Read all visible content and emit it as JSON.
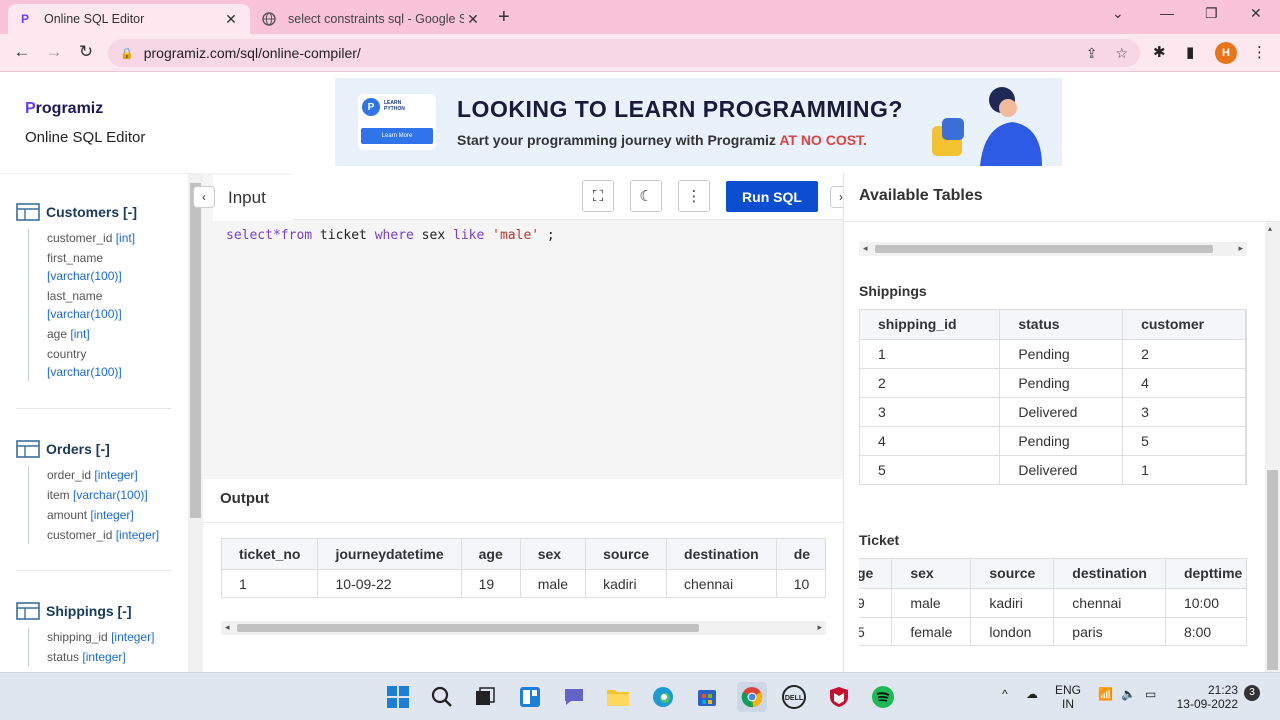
{
  "browser": {
    "tabs": [
      {
        "title": "Online SQL Editor",
        "active": true
      },
      {
        "title": "select constraints sql - Google Se",
        "active": false
      }
    ],
    "url": "programiz.com/sql/online-compiler/",
    "profile_initial": "H"
  },
  "header": {
    "brand": "rogramiz",
    "brand_p": "P",
    "title": "Online SQL Editor"
  },
  "banner": {
    "card_label": "LEARN\nPYTHON",
    "card_button": "Learn More",
    "headline": "LOOKING TO LEARN PROGRAMMING?",
    "sub_prefix": "Start your programming journey with Programiz ",
    "sub_highlight": "AT NO COST."
  },
  "sidebar": {
    "tables": [
      {
        "name": "Customers [-]",
        "columns": [
          {
            "name": "customer_id",
            "type": "[int]"
          },
          {
            "name": "first_name",
            "type": "[varchar(100)]"
          },
          {
            "name": "last_name",
            "type": "[varchar(100)]"
          },
          {
            "name": "age",
            "type": "[int]"
          },
          {
            "name": "country",
            "type": "[varchar(100)]"
          }
        ]
      },
      {
        "name": "Orders [-]",
        "columns": [
          {
            "name": "order_id",
            "type": "[integer]"
          },
          {
            "name": "item",
            "type": "[varchar(100)]"
          },
          {
            "name": "amount",
            "type": "[integer]"
          },
          {
            "name": "customer_id",
            "type": "[integer]"
          }
        ]
      },
      {
        "name": "Shippings [-]",
        "columns": [
          {
            "name": "shipping_id",
            "type": "[integer]"
          },
          {
            "name": "status",
            "type": "[integer]"
          }
        ]
      }
    ]
  },
  "editor": {
    "input_label": "Input",
    "run_label": "Run SQL",
    "code": {
      "kw1": "select*from",
      "t1": " ticket ",
      "kw2": "where",
      "t2": " sex ",
      "kw3": "like",
      "t3": " ",
      "str": "'male'",
      "t4": " ;"
    }
  },
  "output": {
    "title": "Output",
    "columns": [
      "ticket_no",
      "journeydatetime",
      "age",
      "sex",
      "source",
      "destination",
      "de"
    ],
    "rows": [
      [
        "1",
        "10-09-22",
        "19",
        "male",
        "kadiri",
        "chennai",
        "10"
      ]
    ]
  },
  "right": {
    "title": "Available Tables",
    "shippings_label": "Shippings",
    "shippings_columns": [
      "shipping_id",
      "status",
      "customer"
    ],
    "shippings_rows": [
      [
        "1",
        "Pending",
        "2"
      ],
      [
        "2",
        "Pending",
        "4"
      ],
      [
        "3",
        "Delivered",
        "3"
      ],
      [
        "4",
        "Pending",
        "5"
      ],
      [
        "5",
        "Delivered",
        "1"
      ]
    ],
    "ticket_label": "Ticket",
    "ticket_columns": [
      "ge",
      "sex",
      "source",
      "destination",
      "depttime"
    ],
    "ticket_rows": [
      [
        "9",
        "male",
        "kadiri",
        "chennai",
        "10:00"
      ],
      [
        "5",
        "female",
        "london",
        "paris",
        "8:00"
      ]
    ]
  },
  "taskbar": {
    "lang_top": "ENG",
    "lang_bottom": "IN",
    "time": "21:23",
    "date": "13-09-2022",
    "notif_count": "3"
  }
}
